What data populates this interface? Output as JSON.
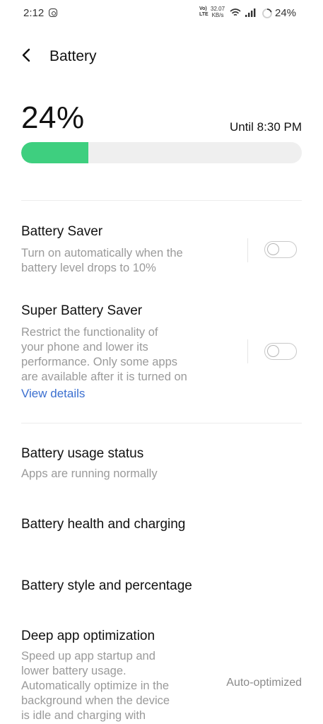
{
  "status_bar": {
    "time": "2:12",
    "volte": [
      "Vo)",
      "LTE"
    ],
    "speed": [
      "32.07",
      "KB/s"
    ],
    "battery_pct": "24%"
  },
  "header": {
    "title": "Battery"
  },
  "battery": {
    "percent_text": "24%",
    "level": 0.24,
    "until": "Until 8:30 PM",
    "bar_color": "#3ecf7f"
  },
  "items": {
    "battery_saver": {
      "title": "Battery Saver",
      "subtitle": [
        "Turn on automatically when the",
        "battery level drops to 10%"
      ],
      "enabled": false
    },
    "super_battery_saver": {
      "title": "Super Battery Saver",
      "subtitle": [
        "Restrict the functionality of",
        "your phone and lower its",
        "performance. Only some apps",
        "are available after it is turned on"
      ],
      "link": "View details",
      "enabled": false
    },
    "usage_status": {
      "title": "Battery usage status",
      "subtitle": "Apps are running normally"
    },
    "health": {
      "title": "Battery health and charging"
    },
    "style": {
      "title": "Battery style and percentage"
    },
    "deep_opt": {
      "title": "Deep app optimization",
      "subtitle": [
        "Speed up app startup and",
        "lower battery usage.",
        "Automatically optimize in the",
        "background when the device",
        "is idle and charging with"
      ],
      "value": "Auto-optimized"
    }
  },
  "colors": {
    "link": "#3b6fd0",
    "secondary_text": "#9a9a9a"
  }
}
